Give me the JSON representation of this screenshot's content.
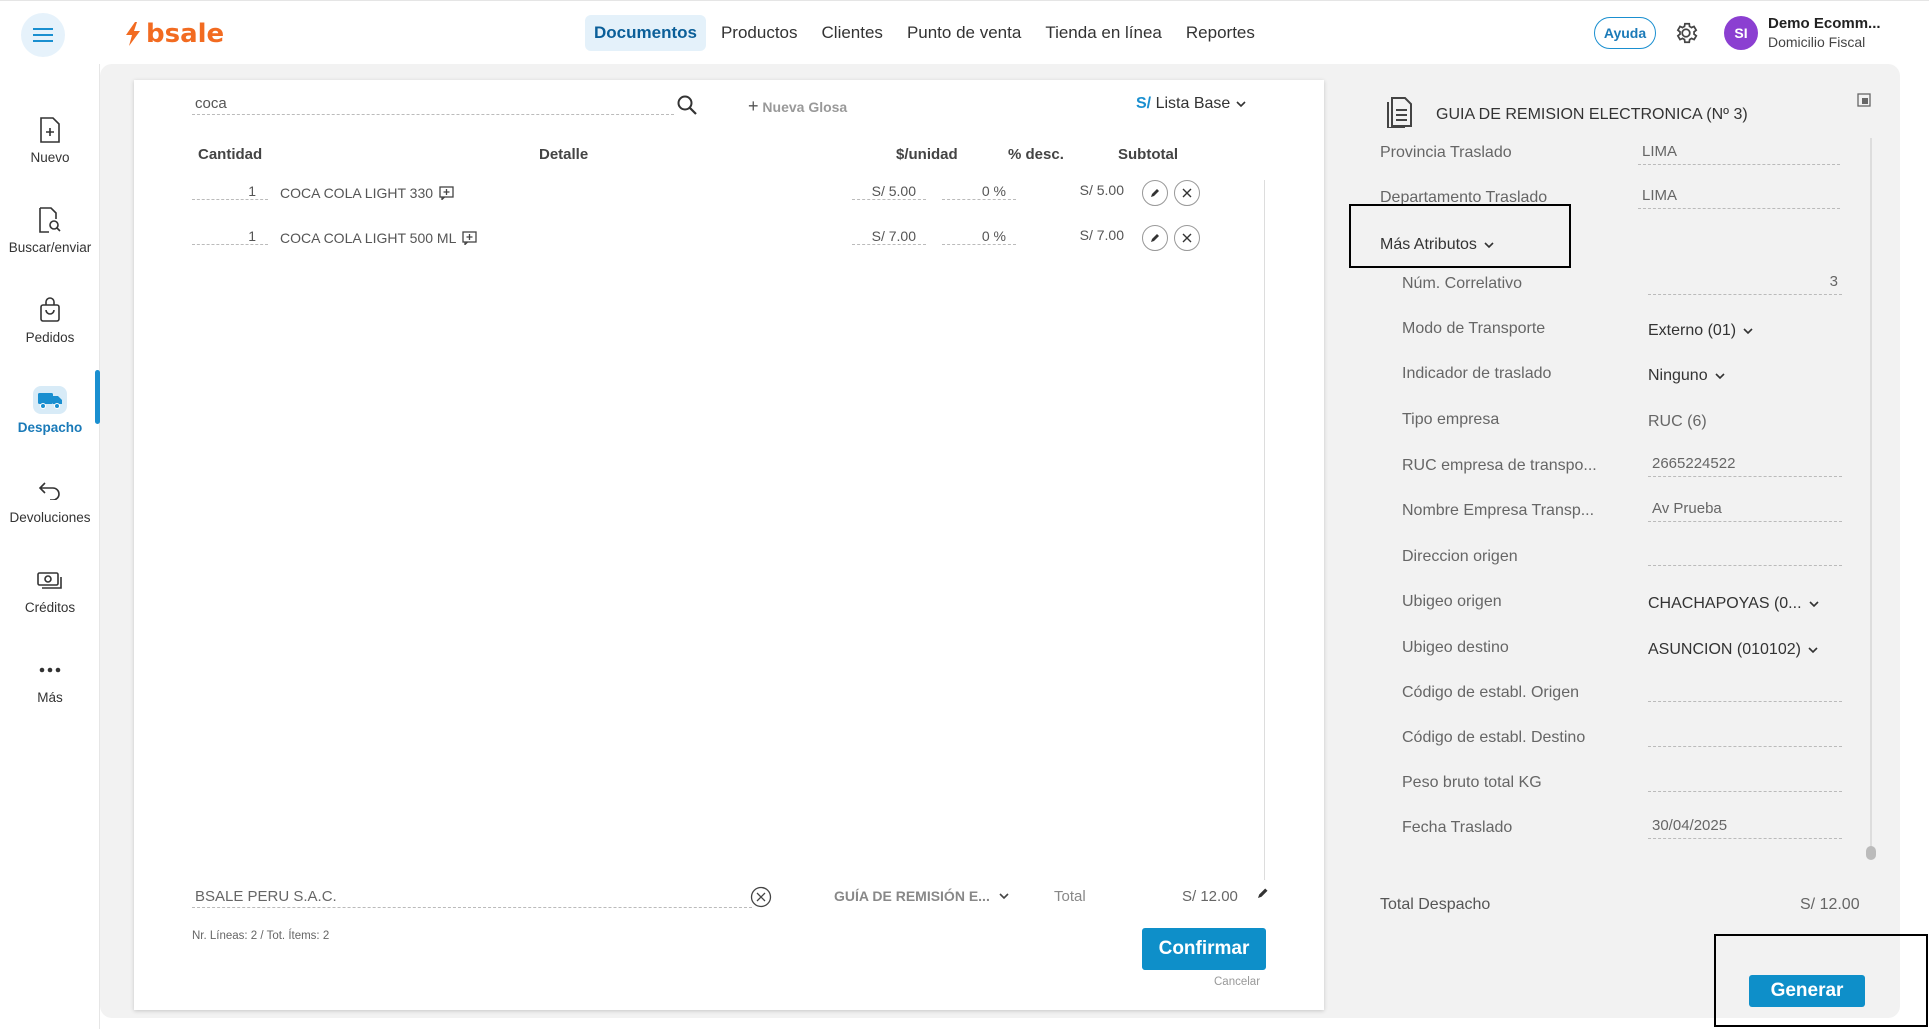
{
  "brand": {
    "logo_text": "bsale",
    "accent": "#f26b21"
  },
  "nav": {
    "items": [
      {
        "label": "Documentos"
      },
      {
        "label": "Productos"
      },
      {
        "label": "Clientes"
      },
      {
        "label": "Punto de venta"
      },
      {
        "label": "Tienda en línea"
      },
      {
        "label": "Reportes"
      }
    ],
    "help_label": "Ayuda"
  },
  "user": {
    "initials": "SI",
    "name": "Demo Ecomm...",
    "subtitle": "Domicilio Fiscal"
  },
  "sidebar": {
    "items": [
      {
        "label": "Nuevo",
        "icon": "file-plus-icon"
      },
      {
        "label": "Buscar/enviar",
        "icon": "file-search-icon"
      },
      {
        "label": "Pedidos",
        "icon": "bag-icon"
      },
      {
        "label": "Despacho",
        "icon": "truck-icon"
      },
      {
        "label": "Devoluciones",
        "icon": "undo-arrow-icon"
      },
      {
        "label": "Créditos",
        "icon": "money-icon"
      },
      {
        "label": "Más",
        "icon": "dots-icon"
      }
    ]
  },
  "document": {
    "search_value": "coca",
    "nueva_glosa_label": "Nueva Glosa",
    "price_list": {
      "currency": "S/",
      "label": "Lista Base"
    },
    "columns": {
      "qty": "Cantidad",
      "detail": "Detalle",
      "unit_price": "$/unidad",
      "discount": "% desc.",
      "subtotal": "Subtotal"
    },
    "lines": [
      {
        "qty": "1",
        "product": "COCA COLA LIGHT 330",
        "unit_price": "S/ 5.00",
        "discount": "0 %",
        "subtotal": "S/ 5.00"
      },
      {
        "qty": "1",
        "product": "COCA COLA LIGHT 500 ML",
        "unit_price": "S/ 7.00",
        "discount": "0 %",
        "subtotal": "S/ 7.00"
      }
    ],
    "client": "BSALE PERU S.A.C.",
    "doc_type": "GUÍA DE REMISIÓN E...",
    "total_label": "Total",
    "total_value": "S/ 12.00",
    "lines_info": "Nr. Líneas: 2 / Tot. Ítems: 2",
    "confirm_label": "Confirmar",
    "cancel_label": "Cancelar"
  },
  "right_panel": {
    "title": "GUIA DE REMISION ELECTRONICA (Nº 3)",
    "fields_top": [
      {
        "label": "Provincia Traslado",
        "value": "LIMA"
      },
      {
        "label": "Departamento Traslado",
        "value": "LIMA"
      }
    ],
    "more_attributes_label": "Más Atributos",
    "attributes": [
      {
        "label": "Núm. Correlativo",
        "value": "3",
        "kind": "input-right"
      },
      {
        "label": "Modo de Transporte",
        "value": "Externo (01)",
        "kind": "select"
      },
      {
        "label": "Indicador de traslado",
        "value": "Ninguno",
        "kind": "select"
      },
      {
        "label": "Tipo empresa",
        "value": "RUC (6)",
        "kind": "text"
      },
      {
        "label": "RUC empresa de transpo...",
        "value": "2665224522",
        "kind": "input"
      },
      {
        "label": "Nombre Empresa Transp...",
        "value": "Av Prueba",
        "kind": "input"
      },
      {
        "label": "Direccion origen",
        "value": "",
        "kind": "input"
      },
      {
        "label": "Ubigeo origen",
        "value": "CHACHAPOYAS (0...",
        "kind": "select"
      },
      {
        "label": "Ubigeo destino",
        "value": "ASUNCION (010102)",
        "kind": "select"
      },
      {
        "label": "Código de establ. Origen",
        "value": "",
        "kind": "input"
      },
      {
        "label": "Código de establ. Destino",
        "value": "",
        "kind": "input"
      },
      {
        "label": "Peso bruto total KG",
        "value": "",
        "kind": "input"
      },
      {
        "label": "Fecha Traslado",
        "value": "30/04/2025",
        "kind": "input"
      }
    ],
    "total_label": "Total Despacho",
    "total_value": "S/ 12.00",
    "generate_label": "Generar"
  }
}
